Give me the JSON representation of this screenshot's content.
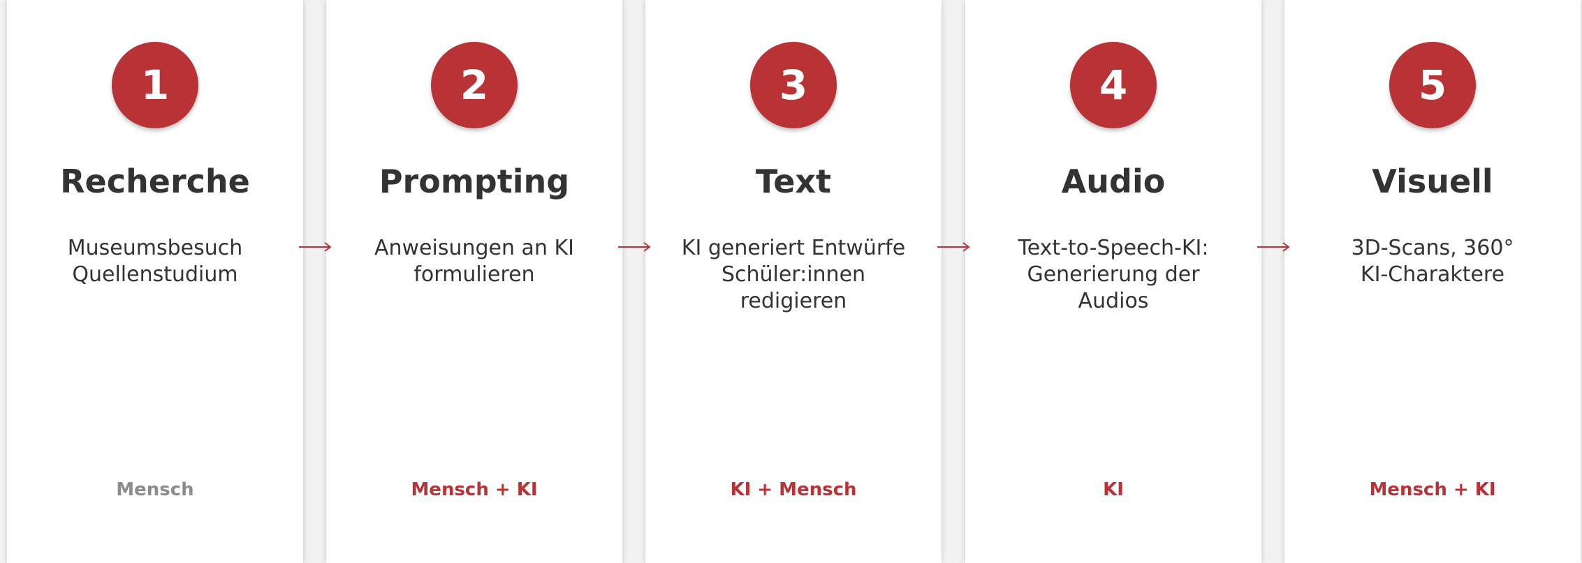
{
  "steps": [
    {
      "number": "1",
      "title": "Recherche",
      "lines": [
        "Museumsbesuch",
        "Quellenstudium"
      ],
      "actor": "Mensch"
    },
    {
      "number": "2",
      "title": "Prompting",
      "lines": [
        "Anweisungen an KI",
        "formulieren"
      ],
      "actor": "Mensch + KI"
    },
    {
      "number": "3",
      "title": "Text",
      "lines": [
        "KI generiert Entwürfe",
        "Schüler:innen",
        "redigieren"
      ],
      "actor": "KI + Mensch"
    },
    {
      "number": "4",
      "title": "Audio",
      "lines": [
        "Text-to-Speech-KI:",
        "Generierung der",
        "Audios"
      ],
      "actor": "KI"
    },
    {
      "number": "5",
      "title": "Visuell",
      "lines": [
        "3D-Scans, 360°",
        "KI-Charaktere"
      ],
      "actor": "Mensch + KI"
    }
  ],
  "colors": {
    "accent": "#b93236",
    "human_actor": "#8c8c8c",
    "text": "#333333",
    "background": "#f2f2f2",
    "card": "#ffffff"
  },
  "icons": {
    "connector": "arrow-right-icon"
  }
}
